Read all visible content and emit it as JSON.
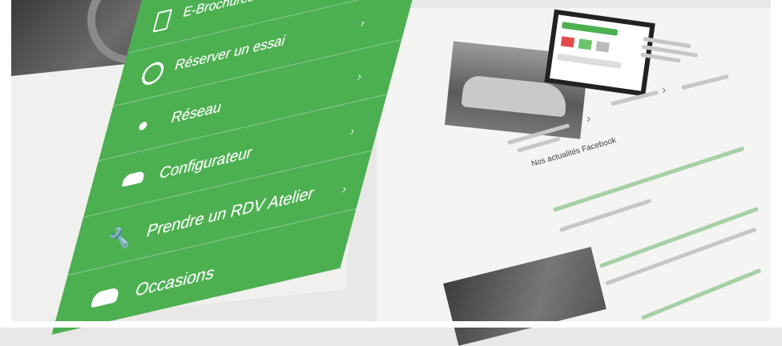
{
  "menu": {
    "items": [
      {
        "label": "E-Brochures & Tarifs",
        "icon": "brochure-icon"
      },
      {
        "label": "Réserver un essai",
        "icon": "steering-wheel-icon"
      },
      {
        "label": "Réseau",
        "icon": "location-pin-icon"
      },
      {
        "label": "Configurateur",
        "icon": "car-config-icon"
      },
      {
        "label": "Prendre un RDV Atelier",
        "icon": "wrench-icon"
      },
      {
        "label": "Occasions",
        "icon": "car-icon"
      }
    ]
  },
  "news": {
    "heading": "Nos actualités Facebook"
  },
  "colors": {
    "menu_green": "#4caf50",
    "link_green": "#3c9a42"
  }
}
